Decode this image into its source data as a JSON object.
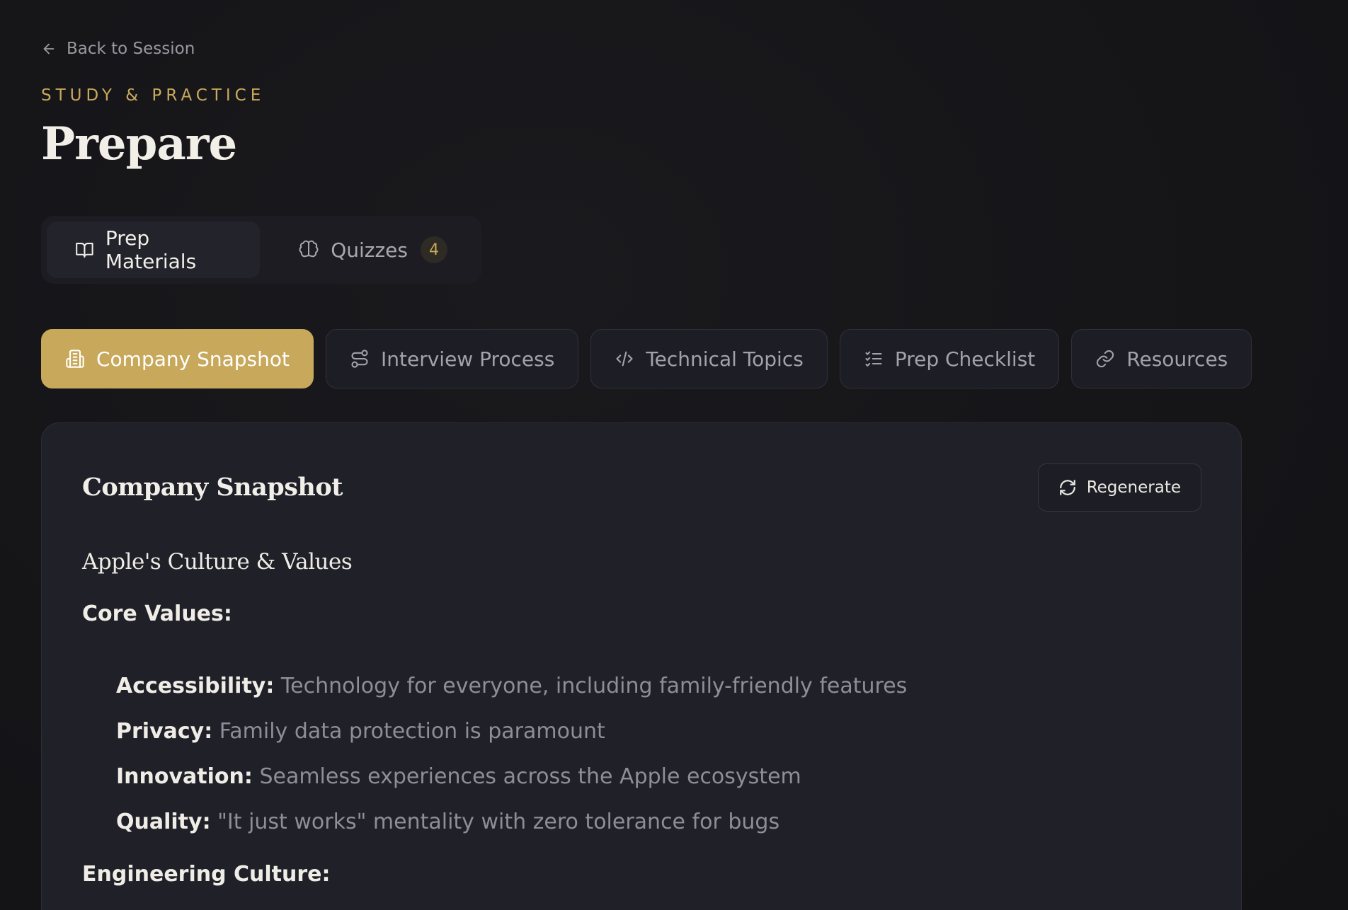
{
  "nav": {
    "back_label": "Back to Session"
  },
  "header": {
    "eyebrow": "STUDY & PRACTICE",
    "title": "Prepare"
  },
  "main_tabs": [
    {
      "label": "Prep Materials",
      "icon": "book-open-icon",
      "active": true
    },
    {
      "label": "Quizzes",
      "icon": "brain-icon",
      "badge": "4",
      "active": false
    }
  ],
  "section_tabs": [
    {
      "label": "Company Snapshot",
      "icon": "building-icon",
      "active": true
    },
    {
      "label": "Interview Process",
      "icon": "route-icon",
      "active": false
    },
    {
      "label": "Technical Topics",
      "icon": "code-icon",
      "active": false
    },
    {
      "label": "Prep Checklist",
      "icon": "checklist-icon",
      "active": false
    },
    {
      "label": "Resources",
      "icon": "link-icon",
      "active": false
    }
  ],
  "card": {
    "title": "Company Snapshot",
    "regenerate_label": "Regenerate",
    "subheading": "Apple's Culture & Values",
    "core_values_label": "Core Values:",
    "core_values": [
      {
        "term": "Accessibility:",
        "desc": "Technology for everyone, including family-friendly features"
      },
      {
        "term": "Privacy:",
        "desc": "Family data protection is paramount"
      },
      {
        "term": "Innovation:",
        "desc": "Seamless experiences across the Apple ecosystem"
      },
      {
        "term": "Quality:",
        "desc": "\"It just works\" mentality with zero tolerance for bugs"
      }
    ],
    "engineering_label": "Engineering Culture:"
  },
  "colors": {
    "background": "#161619",
    "accent_gold": "#c8a85a",
    "card": "#1f2028",
    "muted_text": "#8f8d96"
  }
}
